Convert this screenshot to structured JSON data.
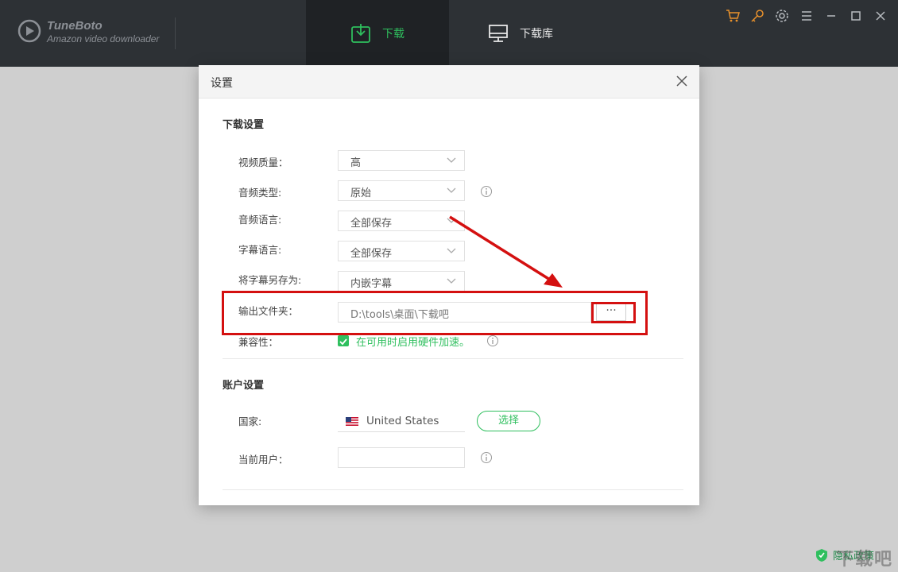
{
  "app": {
    "brand_name": "TuneBoto",
    "brand_subtitle": "Amazon video downloader"
  },
  "tabs": [
    {
      "label": "下载",
      "icon": "download-icon",
      "active": true
    },
    {
      "label": "下载库",
      "icon": "monitor-icon",
      "active": false
    }
  ],
  "window_icons": [
    "cart-icon",
    "key-icon",
    "gear-icon",
    "menu-icon",
    "minimize-icon",
    "maximize-icon",
    "close-icon"
  ],
  "colors": {
    "accent": "#2fbf5e",
    "topbar": "#2d3135",
    "highlight": "#d41010",
    "orange_icons": "#e8912c"
  },
  "dialog": {
    "title": "设置",
    "download_section": {
      "title": "下载设置",
      "video_quality": {
        "label": "视频质量：",
        "value": "高"
      },
      "audio_type": {
        "label": "音频类型:",
        "value": "原始"
      },
      "audio_language": {
        "label": "音频语言:",
        "value": "全部保存"
      },
      "subtitle_language": {
        "label": "字幕语言:",
        "value": "全部保存"
      },
      "save_subtitle_as": {
        "label": "将字幕另存为:",
        "value": "内嵌字幕"
      },
      "output_folder": {
        "label": "输出文件夹：",
        "value": "D:\\tools\\桌面\\下载吧",
        "browse_label": "···"
      },
      "compatibility": {
        "label": "兼容性：",
        "checkbox_label": "在可用时启用硬件加速。",
        "checked": true
      }
    },
    "account_section": {
      "title": "账户设置",
      "country": {
        "label": "国家:",
        "value": "United States",
        "select_button": "选择"
      },
      "current_user": {
        "label": "当前用户：",
        "value": ""
      }
    }
  },
  "footer": {
    "privacy_label": "隐私政策",
    "watermark": "下载吧"
  }
}
